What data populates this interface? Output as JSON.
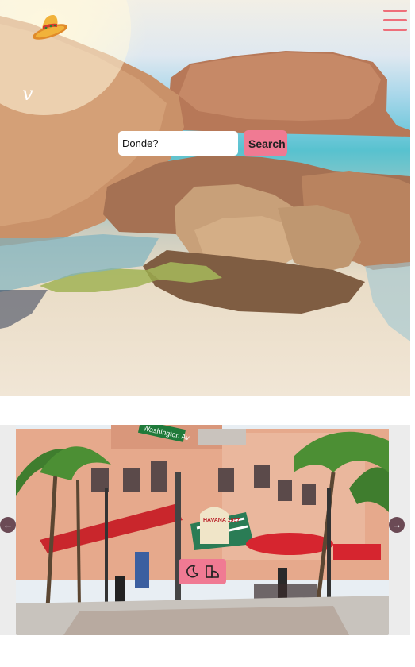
{
  "header": {
    "logo_icon": "sombrero-icon",
    "menu_icon": "hamburger-menu-icon",
    "brand_mark": "v"
  },
  "search": {
    "placeholder": "Donde?",
    "button_label": "Search"
  },
  "carousel": {
    "prev_icon": "arrow-left-icon",
    "next_icon": "arrow-right-icon",
    "prev_glyph": "←",
    "next_glyph": "→",
    "slide_photo": "street-scene-photo",
    "sign_text": "Washington Av",
    "awning_text": "HAVANA 1957",
    "tools": {
      "dark_mode_icon": "moon-icon",
      "contrast_icon": "contrast-shapes-icon"
    }
  },
  "colors": {
    "accent": "#f07a93",
    "menu": "#ee6f7a",
    "arrow": "#6b4a55"
  }
}
